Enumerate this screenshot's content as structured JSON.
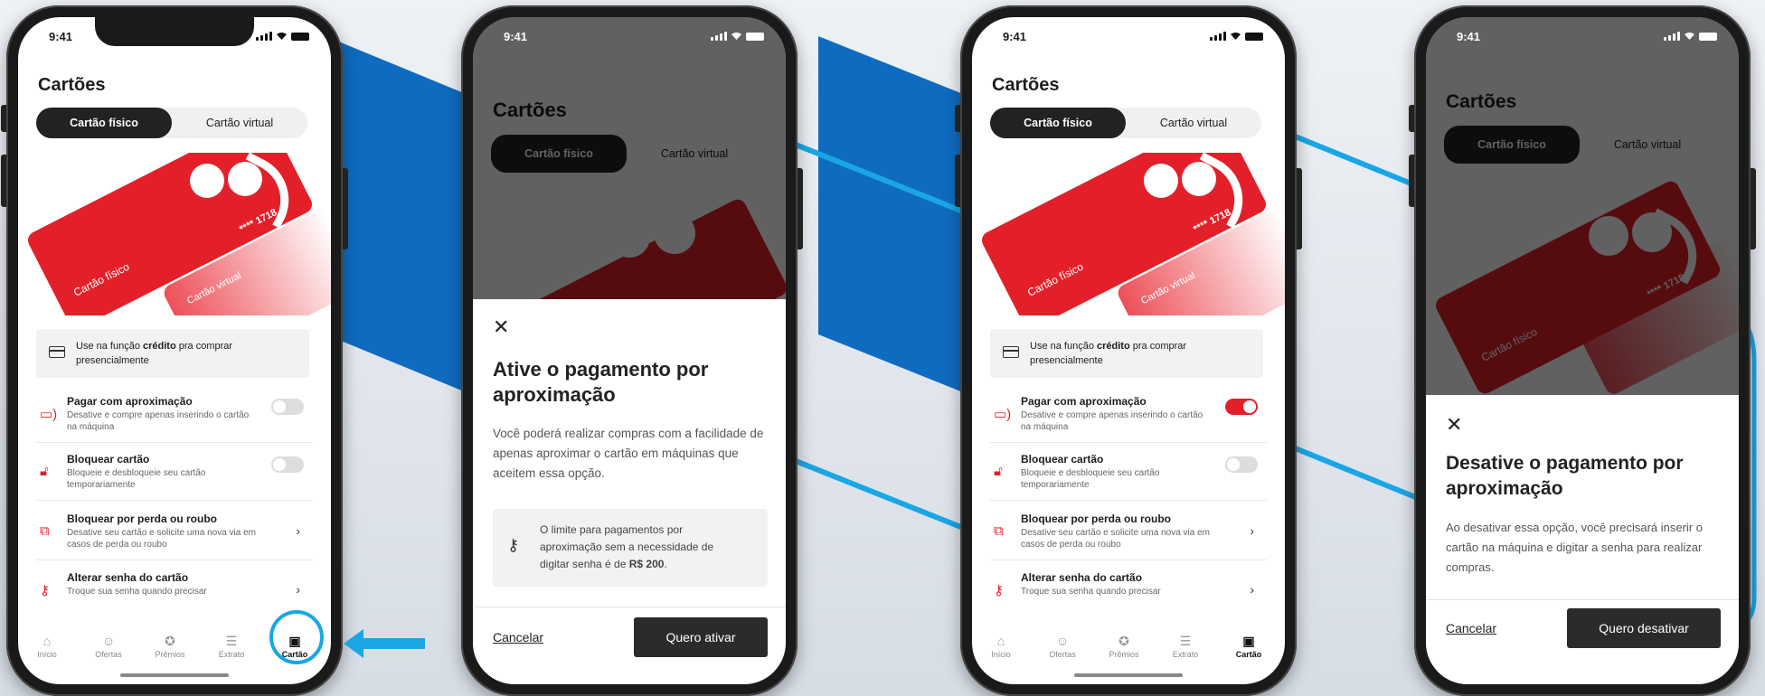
{
  "colors": {
    "accent_red": "#e32029",
    "deco_blue": "#0f6bbf",
    "deco_cyan": "#1aa6e5",
    "dark_button": "#2b2b2b"
  },
  "status": {
    "time": "9:41"
  },
  "app": {
    "title": "Cartões",
    "tabs": [
      "Cartão físico",
      "Cartão virtual"
    ],
    "card_physical_label": "Cartão físico",
    "card_virtual_label": "Cartão virtual",
    "card_number": "**** 1718",
    "info_pre": "Use na função ",
    "info_bold": "crédito",
    "info_post": " pra comprar presencialmente",
    "rows": [
      {
        "title": "Pagar com aproximação",
        "subtitle": "Desative e compre apenas inserindo o cartão na máquina",
        "icon": "contactless-icon"
      },
      {
        "title": "Bloquear cartão",
        "subtitle": "Bloqueie e desbloqueie seu cartão temporariamente",
        "icon": "lock-icon"
      },
      {
        "title": "Bloquear por perda ou roubo",
        "subtitle": "Desative seu cartão e solicite uma nova via em casos de perda ou roubo",
        "icon": "cards-icon"
      },
      {
        "title": "Alterar senha do cartão",
        "subtitle": "Troque sua senha quando precisar",
        "icon": "key-icon"
      }
    ],
    "nav": [
      "Início",
      "Ofertas",
      "Prêmios",
      "Extrato",
      "Cartão"
    ]
  },
  "screens": [
    {
      "contactless_on": false
    },
    {
      "sheet": {
        "title": "Ative o pagamento por aproximação",
        "body": "Você poderá realizar compras com a facilidade de apenas aproximar o cartão em máquinas que aceitem essa opção.",
        "box_text": "O limite para pagamentos por aproximação sem a necessidade de digitar senha é de ",
        "box_bold": "R$ 200",
        "box_end": ".",
        "cancel": "Cancelar",
        "confirm": "Quero ativar"
      }
    },
    {
      "contactless_on": true
    },
    {
      "sheet": {
        "title": "Desative o pagamento por aproximação",
        "body": "Ao desativar essa opção, você precisará inserir o cartão na máquina e digitar a senha para realizar compras.",
        "cancel": "Cancelar",
        "confirm": "Quero desativar"
      }
    }
  ]
}
